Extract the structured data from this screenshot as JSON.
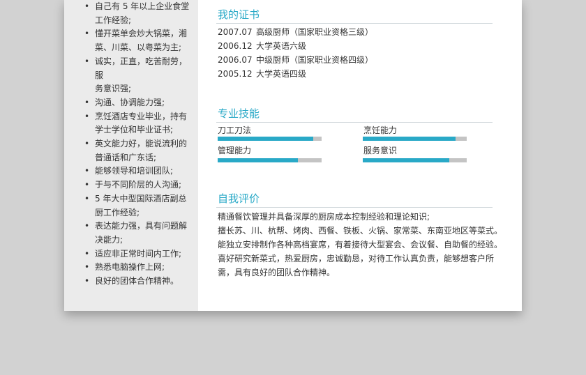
{
  "sidebar": {
    "items": [
      [
        "自己有 5 年以上企业食堂",
        "工作经验;"
      ],
      [
        "懂开菜单会炒大锅菜，湘",
        "菜、川菜、以粤菜为主;"
      ],
      [
        "诚实，正直，吃苦耐劳，服",
        "务意识强;"
      ],
      [
        "沟通、协调能力强;"
      ],
      [
        "烹饪酒店专业毕业，持有",
        "学士学位和毕业证书;"
      ],
      [
        "英文能力好，能说流利的",
        "普通话和广东话;"
      ],
      [
        "能够领导和培训团队;"
      ],
      [
        "于与不同阶层的人沟通;"
      ],
      [
        "5 年大中型国际酒店副总",
        "厨工作经验;"
      ],
      [
        "表达能力强，具有问题解",
        "决能力;"
      ],
      [
        "适应非正常时间内工作;"
      ],
      [
        "熟悉电脑操作上网;"
      ],
      [
        "良好的团体合作精神。"
      ]
    ]
  },
  "certificates": {
    "title": "我的证书",
    "items": [
      {
        "date": "2007.07",
        "name": "高级厨师（国家职业资格三级）"
      },
      {
        "date": "2006.12",
        "name": "大学英语六级"
      },
      {
        "date": "2006.07",
        "name": "中级厨师（国家职业资格四级）"
      },
      {
        "date": "2005.12",
        "name": "大学英语四级"
      }
    ]
  },
  "skills": {
    "title": "专业技能",
    "items": [
      {
        "name": "刀工刀法",
        "level": 0.92
      },
      {
        "name": "烹饪能力",
        "level": 0.89
      },
      {
        "name": "管理能力",
        "level": 0.77
      },
      {
        "name": "服务意识",
        "level": 0.83
      }
    ]
  },
  "self_evaluation": {
    "title": "自我评价",
    "lines": [
      "精通餐饮管理并具备深厚的厨房成本控制经验和理论知识;",
      "擅长苏、川、杭帮、烤肉、西餐、铁板、火锅、家常菜、东南亚地区等菜式。",
      "能独立安排制作各种高档宴席，有着接待大型宴会、会议餐、自助餐的经验。",
      "喜好研究新菜式，热爱厨房，忠诚勤恳，对待工作认真负责，能够想客户所",
      "需，具有良好的团队合作精神。"
    ]
  },
  "colors": {
    "accent": "#29a9c7",
    "bar_track": "#c4c4c4",
    "sidebar_bg": "#ebebeb",
    "backdrop": "#d2d2d2"
  }
}
